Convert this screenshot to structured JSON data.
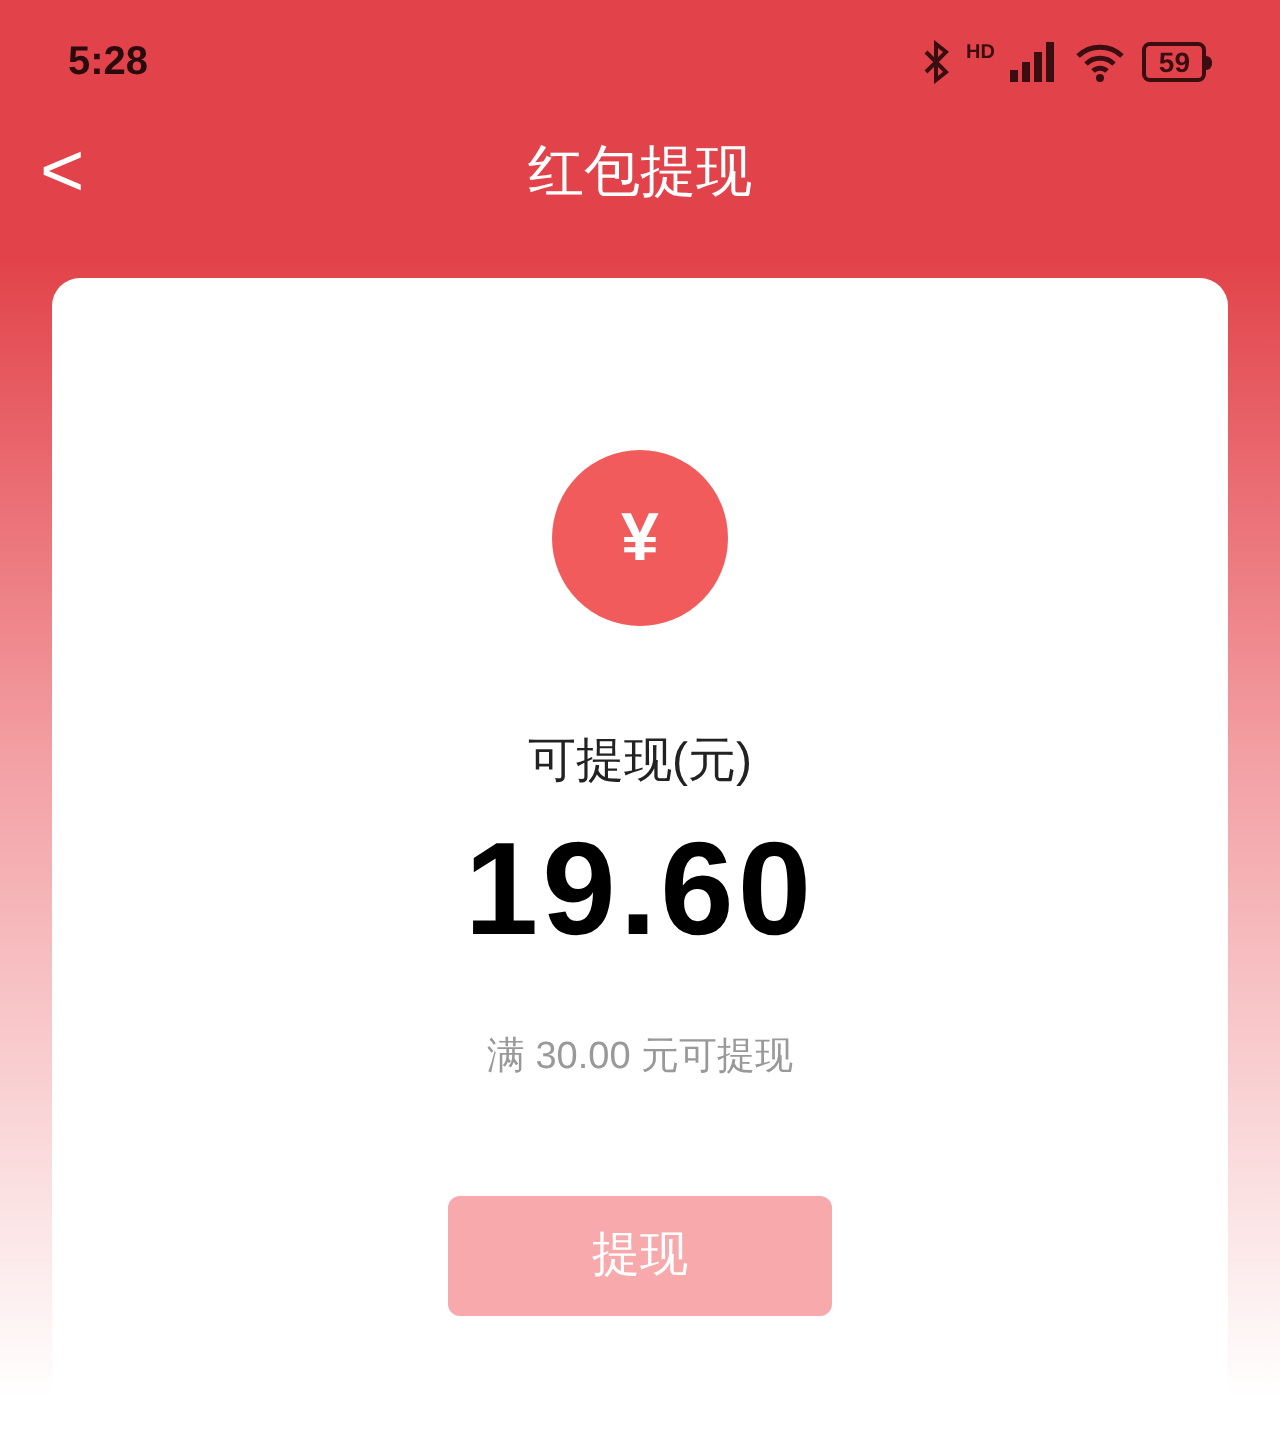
{
  "status_bar": {
    "time": "5:28",
    "network_label": "HD",
    "battery": "59"
  },
  "header": {
    "back": "<",
    "title": "红包提现"
  },
  "card": {
    "currency_icon": "¥",
    "label": "可提现(元)",
    "amount": "19.60",
    "hint": "满 30.00 元可提现",
    "button": {
      "label": "提现",
      "disabled": true
    }
  }
}
